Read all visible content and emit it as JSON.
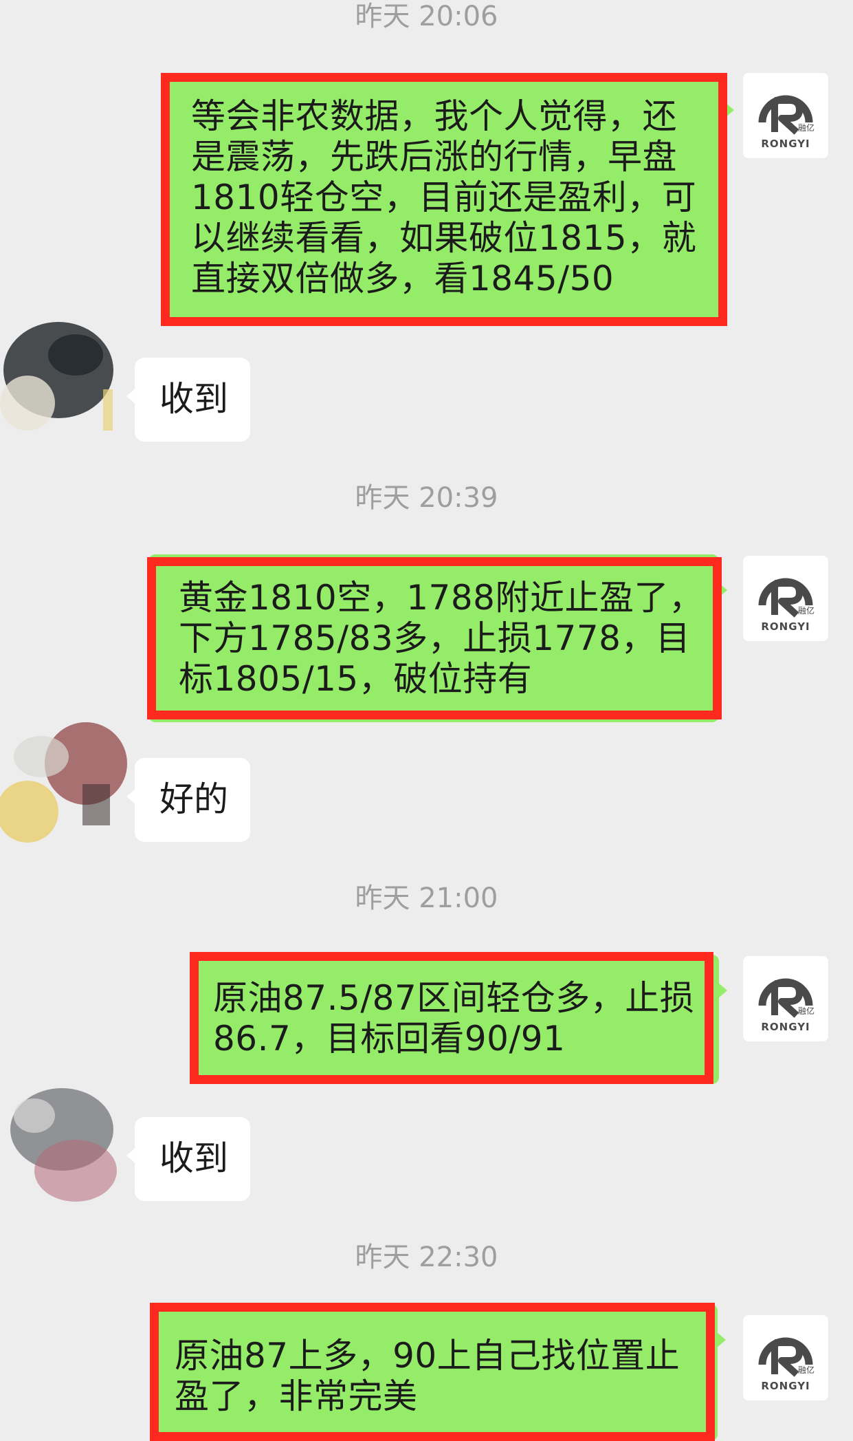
{
  "messages": [
    {
      "time": "昨天 20:06",
      "outgoing": "等会非农数据，我个人觉得，还是震荡，先跌后涨的行情，早盘1810轻仓空，目前还是盈利，可以继续看看，如果破位1815，就直接双倍做多，看1845/50",
      "outgoing_lines": [
        "等会非农数据，我个人觉得，还",
        "是震荡，先跌后涨的行情，早盘",
        "1810轻仓空，目前还是盈利，可",
        "以继续看看，如果破位1815，就",
        "直接双倍做多，看1845/50"
      ],
      "reply": "收到"
    },
    {
      "time": "昨天 20:39",
      "outgoing": "黄金1810空，1788附近止盈了，下方1785/83多，止损1778，目标1805/15，破位持有",
      "outgoing_lines": [
        "黄金1810空，1788附近止盈了，",
        "下方1785/83多，止损1778，目",
        "标1805/15，破位持有"
      ],
      "reply": "好的"
    },
    {
      "time": "昨天 21:00",
      "outgoing": "原油87.5/87区间轻仓多，止损86.7，目标回看90/91",
      "outgoing_lines": [
        "原油87.5/87区间轻仓多，止损",
        "86.7，目标回看90/91"
      ],
      "reply": "收到"
    },
    {
      "time": "昨天 22:30",
      "outgoing": "原油87上多，90上自己找位置止盈了，非常完美",
      "outgoing_lines": [
        "原油87上多，90上自己找位置止",
        "盈了，非常完美"
      ]
    }
  ],
  "sender_avatar": {
    "logo_text": "RONGYI",
    "logo_cn": "融亿",
    "icon": "rongyi-logo-icon"
  },
  "colors": {
    "background": "#ededed",
    "outgoing_bubble": "#95ec69",
    "highlight_frame": "#ff2a1f",
    "timestamp": "#9e9e9e"
  }
}
